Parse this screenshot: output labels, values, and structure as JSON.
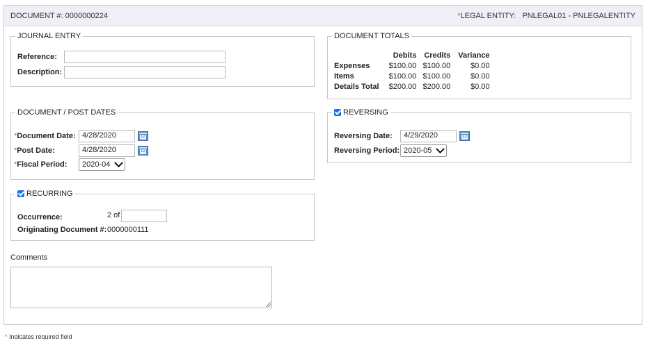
{
  "header": {
    "document_label": "DOCUMENT #:",
    "document_number": "0000000224",
    "legal_entity_label": "LEGAL ENTITY:",
    "legal_entity_value": "PNLEGAL01 - PNLEGALENTITY"
  },
  "journal_entry": {
    "legend": "JOURNAL ENTRY",
    "reference_label": "Reference:",
    "reference_value": "",
    "description_label": "Description:",
    "description_value": ""
  },
  "document_totals": {
    "legend": "DOCUMENT TOTALS",
    "columns": [
      "Debits",
      "Credits",
      "Variance"
    ],
    "rows": [
      {
        "label": "Expenses",
        "debits": "$100.00",
        "credits": "$100.00",
        "variance": "$0.00"
      },
      {
        "label": "Items",
        "debits": "$100.00",
        "credits": "$100.00",
        "variance": "$0.00"
      },
      {
        "label": "Details Total",
        "debits": "$200.00",
        "credits": "$200.00",
        "variance": "$0.00"
      }
    ]
  },
  "dates": {
    "legend": "DOCUMENT / POST DATES",
    "document_date_label": "Document Date:",
    "document_date_value": "4/28/2020",
    "post_date_label": "Post Date:",
    "post_date_value": "4/28/2020",
    "fiscal_period_label": "Fiscal Period:",
    "fiscal_period_value": "2020-04"
  },
  "reversing": {
    "legend": "REVERSING",
    "checked": true,
    "date_label": "Reversing Date:",
    "date_value": "4/29/2020",
    "period_label": "Reversing Period:",
    "period_value": "2020-05"
  },
  "recurring": {
    "legend": "RECURRING",
    "checked": true,
    "occurrence_label": "Occurrence:",
    "occurrence_prefix": "2 of",
    "occurrence_value": "",
    "originating_label": "Originating Document #:",
    "originating_value": "0000000111"
  },
  "comments": {
    "label": "Comments",
    "value": ""
  },
  "footer": {
    "required_note": "Indicates required field"
  },
  "colors": {
    "required_star": "#d9534f",
    "header_bg": "#efeff6",
    "checkbox": "#1a73e8",
    "calendar_icon": "#5a8dc4"
  },
  "icons": [
    "calendar-icon",
    "checkbox-checked-icon",
    "select-chevron-icon",
    "resize-grip-icon"
  ]
}
